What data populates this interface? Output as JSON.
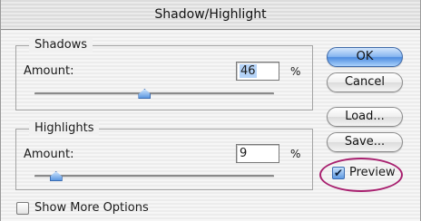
{
  "window": {
    "title": "Shadow/Highlight"
  },
  "shadows": {
    "group_label": "Shadows",
    "amount_label": "Amount:",
    "amount_value": "46",
    "unit": "%",
    "slider_value": 46
  },
  "highlights": {
    "group_label": "Highlights",
    "amount_label": "Amount:",
    "amount_value": "9",
    "unit": "%",
    "slider_value": 9
  },
  "buttons": {
    "ok": "OK",
    "cancel": "Cancel",
    "load": "Load...",
    "save": "Save..."
  },
  "preview": {
    "label": "Preview",
    "checked": true,
    "check_glyph": "✔"
  },
  "more_options": {
    "label": "Show More Options",
    "checked": false
  },
  "colors": {
    "accent_blue": "#5c98e0",
    "highlight_ring": "#a8206f"
  }
}
